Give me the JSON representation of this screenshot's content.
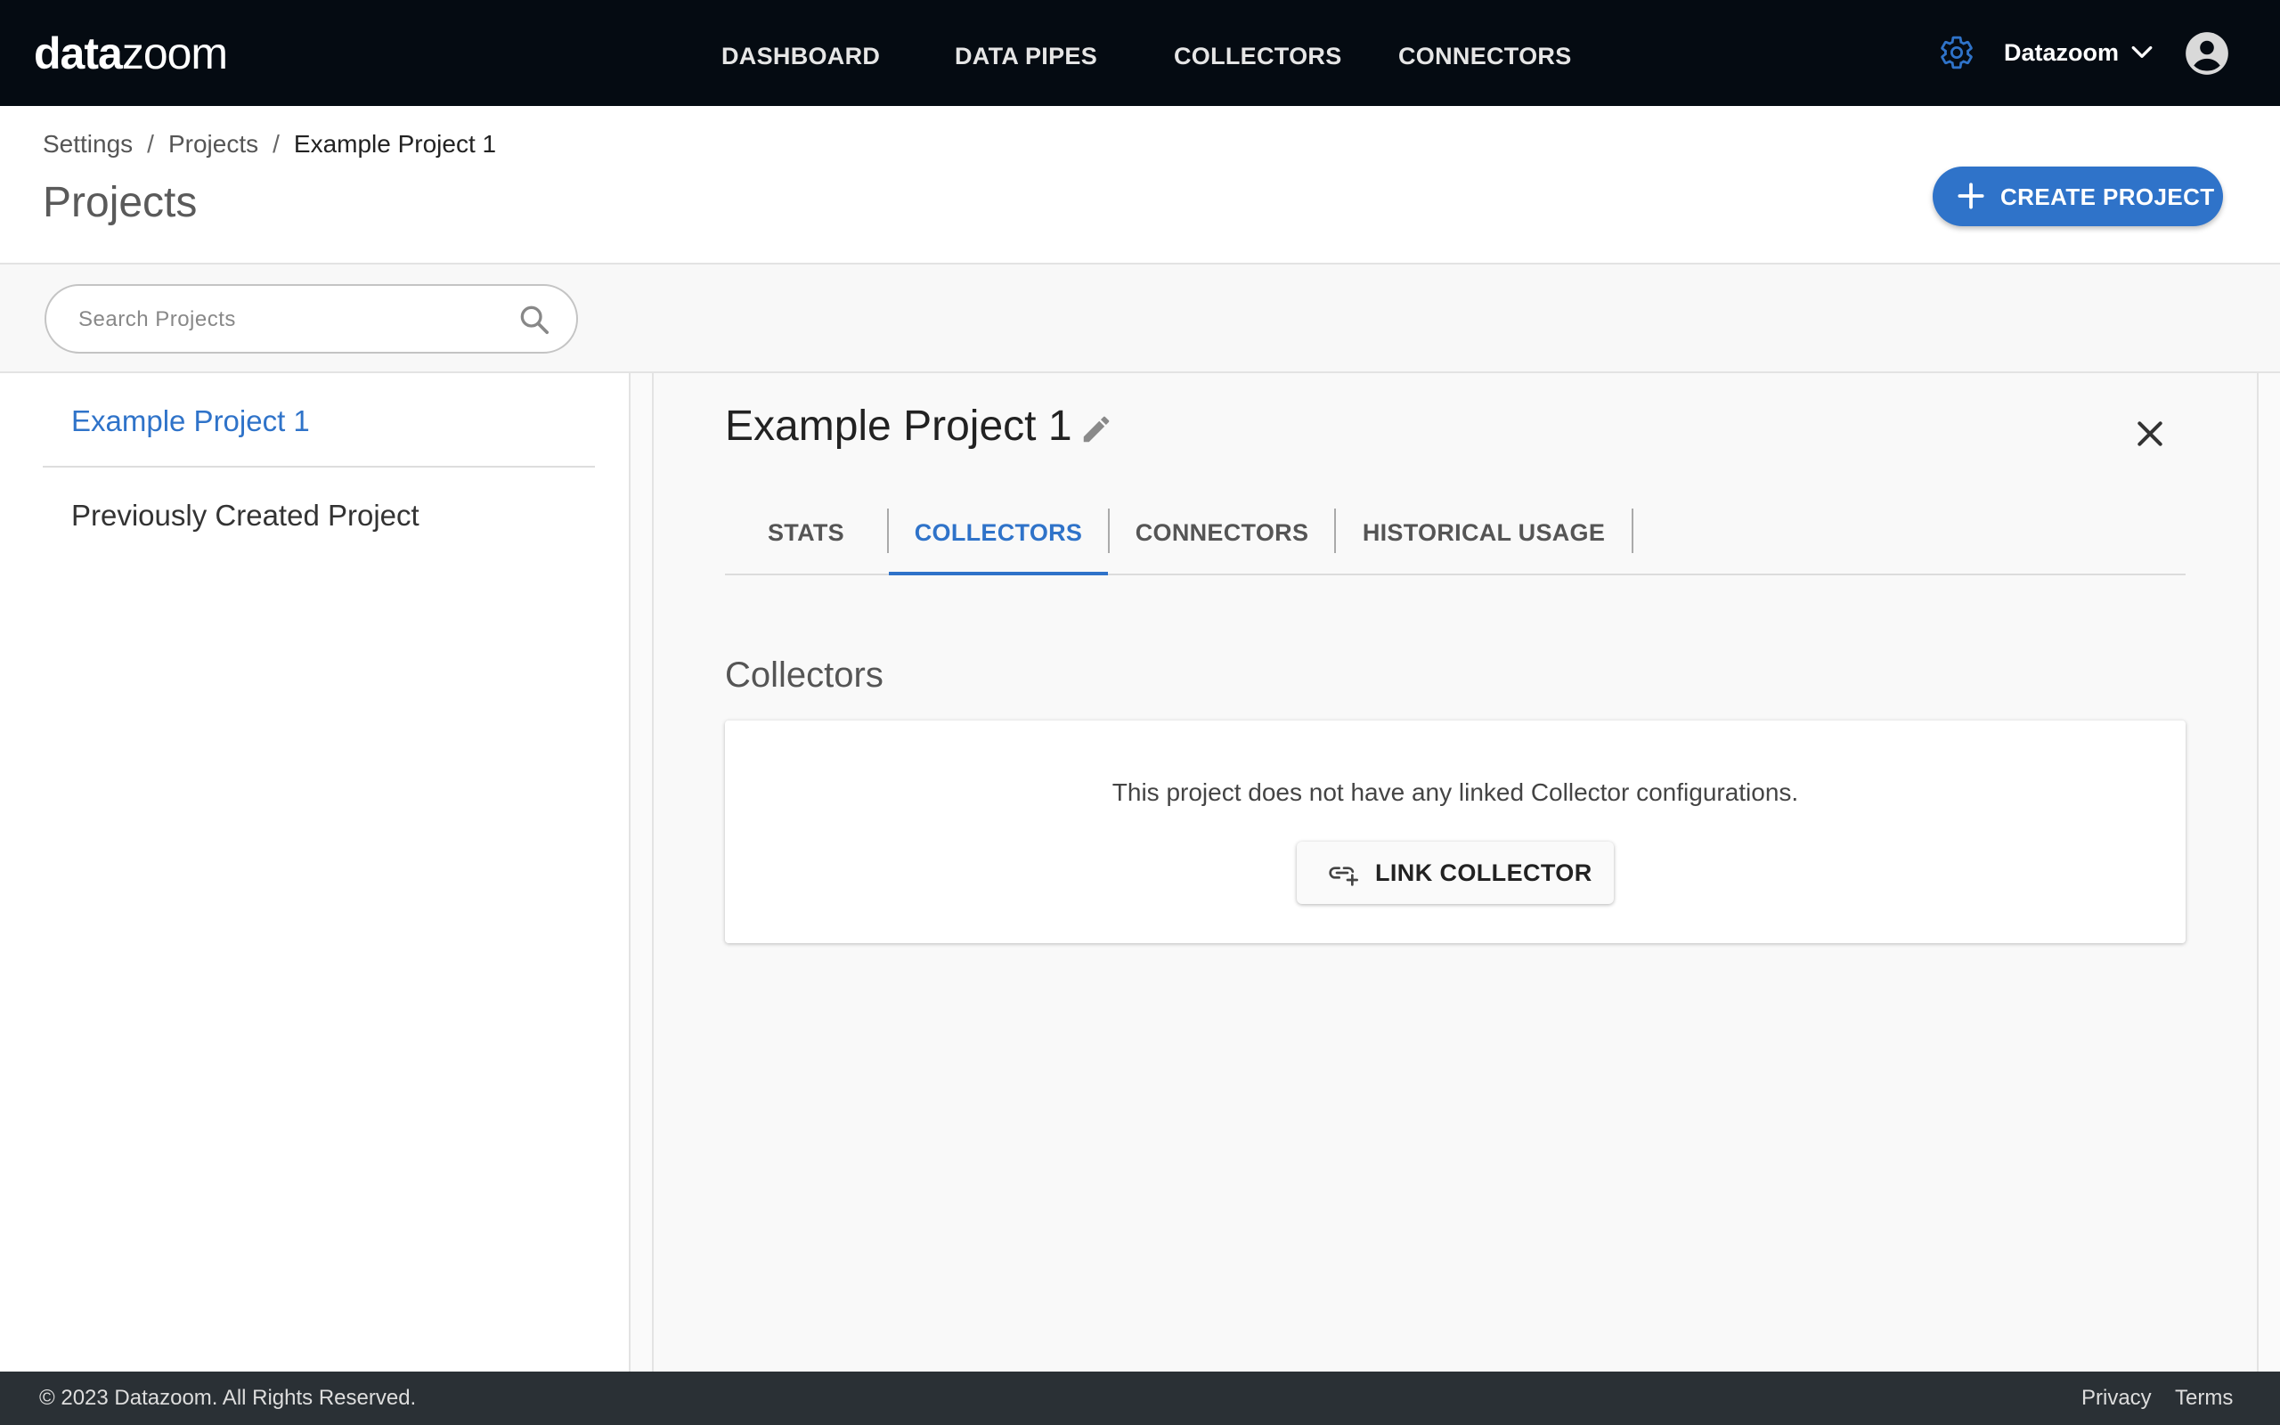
{
  "topbar": {
    "logo_bold": "data",
    "logo_rest": "zoom",
    "nav": [
      "DASHBOARD",
      "DATA PIPES",
      "COLLECTORS",
      "CONNECTORS"
    ],
    "org_name": "Datazoom",
    "icons": {
      "settings": "gear-icon",
      "org_menu": "chevron-down-icon",
      "account": "account-circle-icon"
    },
    "accent_color": "#2f73c9"
  },
  "breadcrumb": [
    "Settings",
    "Projects",
    "Example Project 1"
  ],
  "page_title": "Projects",
  "create_button_label": "CREATE PROJECT",
  "search": {
    "placeholder": "Search Projects",
    "value": ""
  },
  "projects": [
    {
      "name": "Example Project 1",
      "selected": true
    },
    {
      "name": "Previously Created Project",
      "selected": false
    }
  ],
  "detail": {
    "title": "Example Project 1",
    "tabs": [
      "STATS",
      "COLLECTORS",
      "CONNECTORS",
      "HISTORICAL USAGE"
    ],
    "active_tab": "COLLECTORS",
    "section_title": "Collectors",
    "empty_message": "This project does not have any linked Collector configurations.",
    "link_button_label": "LINK COLLECTOR"
  },
  "footer": {
    "copyright": "© 2023 Datazoom. All Rights Reserved.",
    "links": [
      "Privacy",
      "Terms"
    ]
  }
}
